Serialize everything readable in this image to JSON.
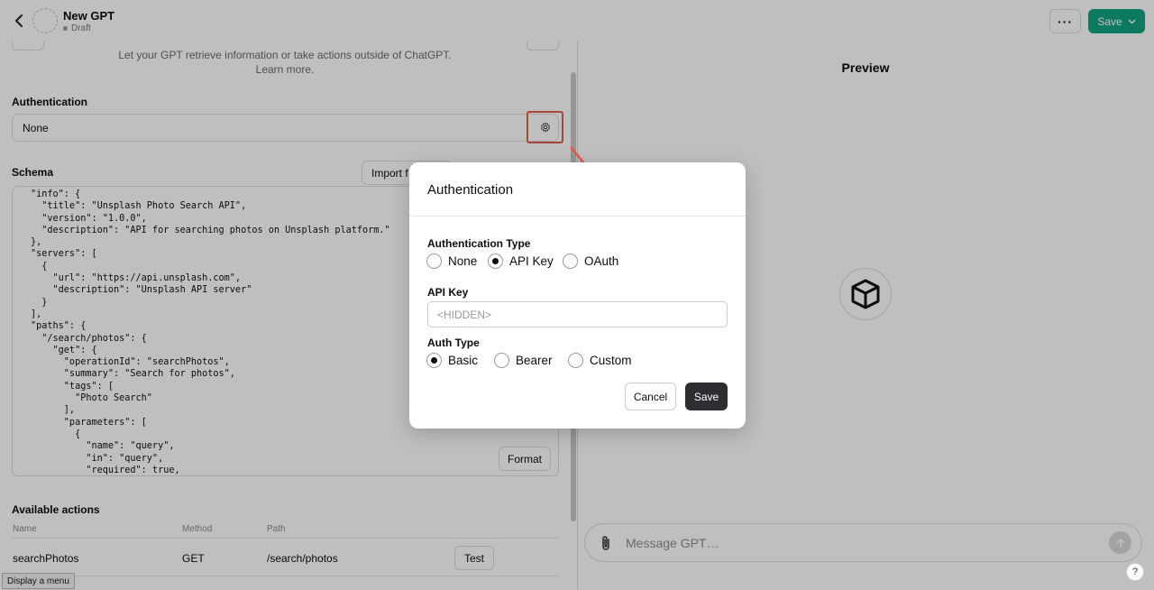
{
  "header": {
    "gpt_name": "New GPT",
    "gpt_status": "Draft",
    "more_label": "···",
    "save_label": "Save"
  },
  "editor": {
    "actions_description_line1": "Let your GPT retrieve information or take actions outside of ChatGPT.",
    "actions_description_line2": "Learn more.",
    "authentication_label": "Authentication",
    "authentication_value": "None",
    "schema_label": "Schema",
    "import_label": "Import f",
    "schema_text": "\"info\": {\n  \"title\": \"Unsplash Photo Search API\",\n  \"version\": \"1.0.0\",\n  \"description\": \"API for searching photos on Unsplash platform.\"\n},\n\"servers\": [\n  {\n    \"url\": \"https://api.unsplash.com\",\n    \"description\": \"Unsplash API server\"\n  }\n],\n\"paths\": {\n  \"/search/photos\": {\n    \"get\": {\n      \"operationId\": \"searchPhotos\",\n      \"summary\": \"Search for photos\",\n      \"tags\": [\n        \"Photo Search\"\n      ],\n      \"parameters\": [\n        {\n          \"name\": \"query\",\n          \"in\": \"query\",\n          \"required\": true,",
    "format_label": "Format",
    "available_actions_label": "Available actions",
    "table_headers": [
      "Name",
      "Method",
      "Path"
    ],
    "actions": [
      {
        "name": "searchPhotos",
        "method": "GET",
        "path": "/search/photos",
        "test_label": "Test"
      }
    ],
    "tooltip": "Display a menu"
  },
  "preview": {
    "title": "Preview",
    "message_placeholder": "Message GPT…",
    "help_label": "?"
  },
  "modal": {
    "title": "Authentication",
    "auth_type_label": "Authentication Type",
    "auth_type_options": [
      "None",
      "API Key",
      "OAuth"
    ],
    "auth_type_selected": "API Key",
    "api_key_label": "API Key",
    "api_key_placeholder": "<HIDDEN>",
    "auth_subtype_label": "Auth Type",
    "auth_subtype_options": [
      "Basic",
      "Bearer",
      "Custom"
    ],
    "auth_subtype_selected": "Basic",
    "cancel_label": "Cancel",
    "save_label": "Save"
  },
  "colors": {
    "save_green": "#10a37f",
    "highlight_red": "#e25c4e",
    "dark_button": "#2d2d32"
  }
}
